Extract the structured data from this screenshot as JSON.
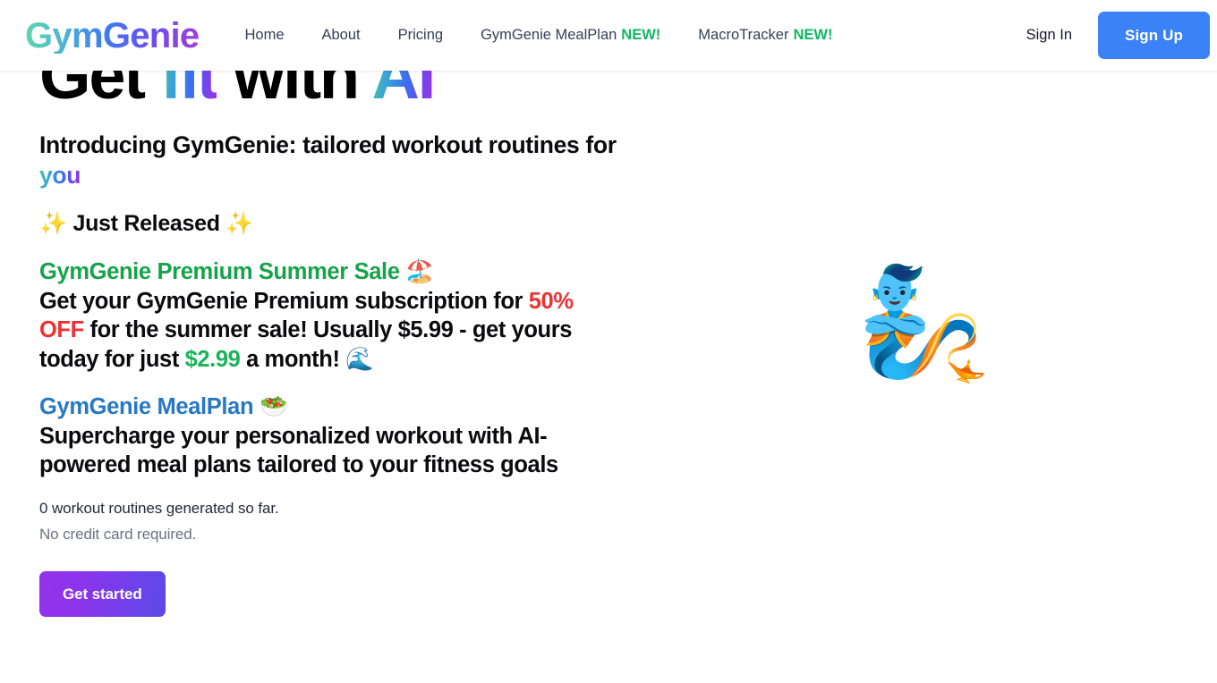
{
  "header": {
    "logo": "GymGenie",
    "nav": [
      {
        "label": "Home",
        "badge": ""
      },
      {
        "label": "About",
        "badge": ""
      },
      {
        "label": "Pricing",
        "badge": ""
      },
      {
        "label": "GymGenie MealPlan",
        "badge": "NEW!"
      },
      {
        "label": "MacroTracker",
        "badge": "NEW!"
      }
    ],
    "sign_in_label": "Sign In",
    "sign_up_label": "Sign Up",
    "badge_color": "#12b764",
    "signup_bg": "#3b82f6"
  },
  "hero": {
    "title_part1": "Get ",
    "title_highlight1": "fit",
    "title_part2": " with ",
    "title_highlight2": "AI",
    "subtitle_plain": "Introducing GymGenie: tailored workout routines for ",
    "subtitle_highlight": "you",
    "just_released": "✨ Just Released ✨",
    "sale": {
      "heading": "GymGenie Premium Summer Sale 🏖️",
      "body_1": "Get your GymGenie Premium subscription for ",
      "discount": "50% OFF",
      "body_2": " for the summer sale! Usually $5.99 - get yours today for just ",
      "price": "$2.99",
      "body_3": " a month! 🌊",
      "heading_color": "#16a34a",
      "discount_color": "#ef3131",
      "price_color": "#19b35a"
    },
    "mealplan": {
      "heading": "GymGenie MealPlan 🥗",
      "body": "Supercharge your personalized workout with AI-powered meal plans tailored to your fitness goals",
      "heading_color": "#2778c4"
    },
    "stat_line": "0 workout routines generated so far.",
    "no_card_line": "No credit card required.",
    "cta_label": "Get started",
    "genie_icon": "🧞"
  }
}
